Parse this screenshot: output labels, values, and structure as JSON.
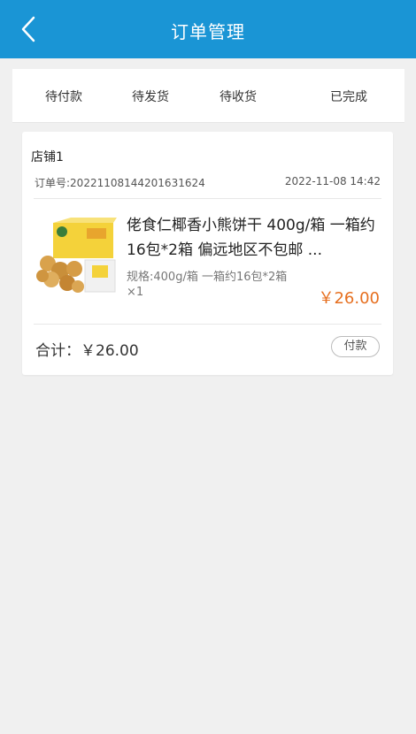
{
  "header": {
    "title": "订单管理",
    "back_icon": "chevron-left-icon",
    "background": "#1a95d5"
  },
  "tabs": [
    {
      "label": "待付款"
    },
    {
      "label": "待发货"
    },
    {
      "label": "待收货"
    },
    {
      "label": "已完成"
    }
  ],
  "order": {
    "shop_name": "店铺1",
    "order_no": "订单号:20221108144201631624",
    "time": "2022-11-08 14:42",
    "product": {
      "name": "佬食仁椰香小熊饼干 400g/箱 一箱约16包*2箱 偏远地区不包邮 ...",
      "spec": "规格:400g/箱 一箱约16包*2箱",
      "quantity": "×1",
      "price": "￥26.00",
      "image_icon": "product-image"
    },
    "total": "合计：￥26.00",
    "pay_button": "付款"
  },
  "colors": {
    "accent": "#1a95d5",
    "price": "#e66f1f"
  }
}
